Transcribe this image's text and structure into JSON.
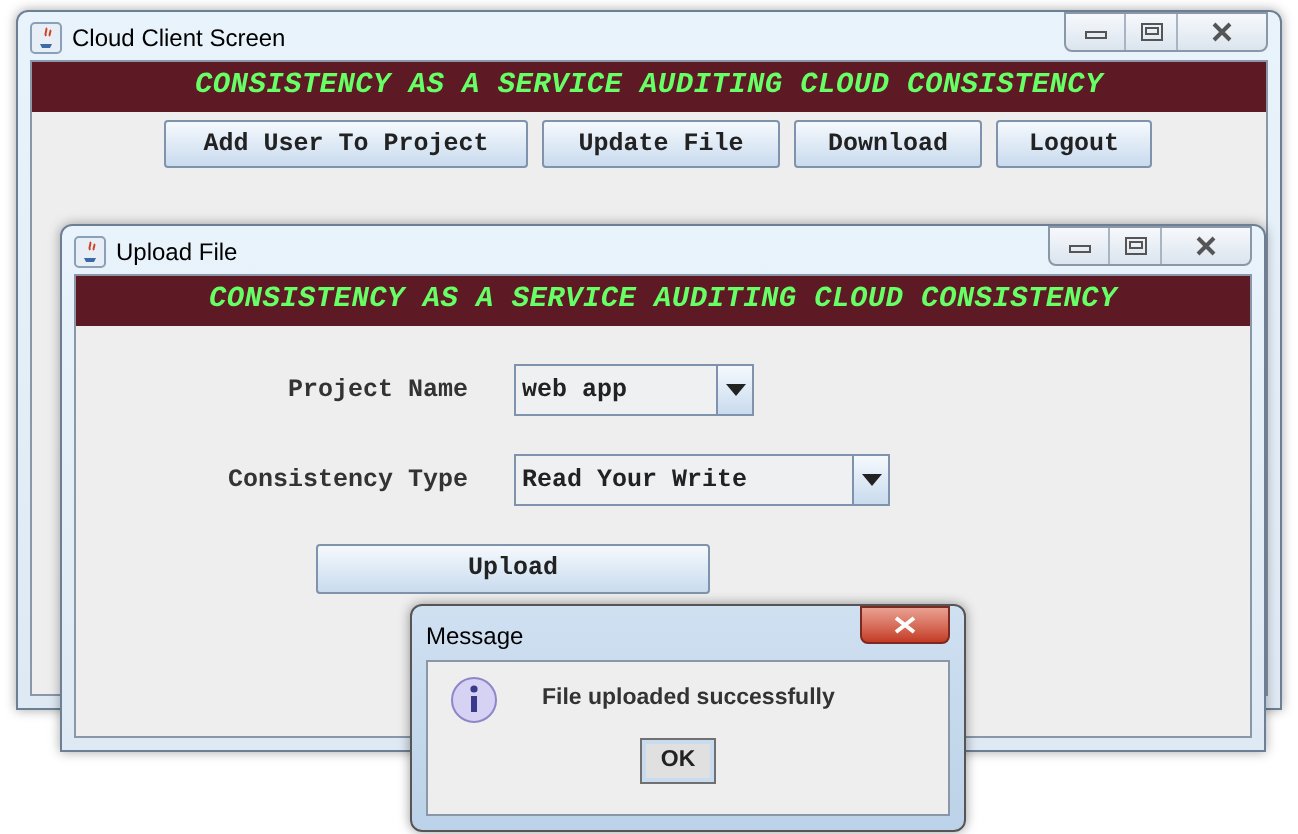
{
  "main_window": {
    "title": "Cloud Client Screen",
    "banner": "CONSISTENCY AS A SERVICE AUDITING CLOUD CONSISTENCY",
    "buttons": [
      "Add User To Project",
      "Update File",
      "Download",
      "Logout"
    ]
  },
  "upload_window": {
    "title": "Upload File",
    "banner": "CONSISTENCY AS A SERVICE AUDITING CLOUD CONSISTENCY",
    "fields": [
      {
        "label": "Project Name",
        "value": "web app"
      },
      {
        "label": "Consistency Type",
        "value": "Read Your Write"
      }
    ],
    "button": "Upload"
  },
  "message_dialog": {
    "title": "Message",
    "text": "File uploaded successfully",
    "button": "OK"
  }
}
